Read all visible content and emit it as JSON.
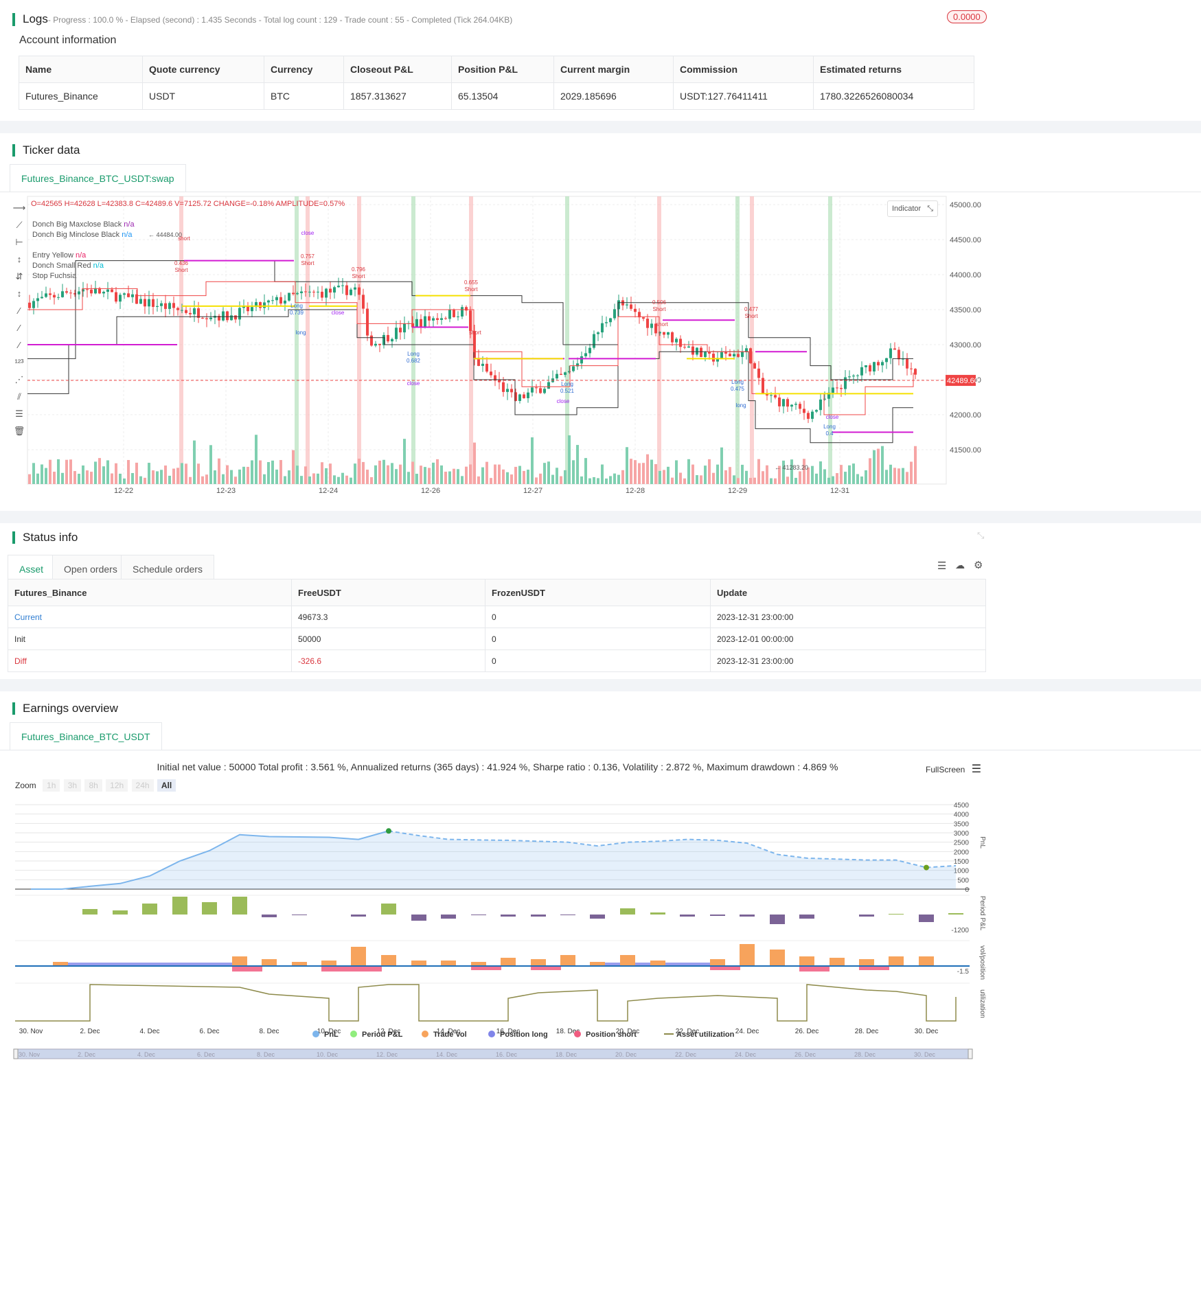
{
  "logs": {
    "title": "Logs",
    "summary": "- Progress : 100.0 % - Elapsed (second) : 1.435  Seconds - Total log count : 129 - Trade count : 55 - Completed (Tick 264.04KB)",
    "badge": "0.0000"
  },
  "account": {
    "title": "Account information",
    "headers": [
      "Name",
      "Quote currency",
      "Currency",
      "Closeout P&L",
      "Position P&L",
      "Current margin",
      "Commission",
      "Estimated returns"
    ],
    "row": [
      "Futures_Binance",
      "USDT",
      "BTC",
      "1857.313627",
      "65.13504",
      "2029.185696",
      "USDT:127.76411411",
      "1780.3226526080034"
    ]
  },
  "ticker": {
    "title": "Ticker data",
    "tab": "Futures_Binance_BTC_USDT:swap",
    "ohlc": "O=42565 H=42628 L=42383.8 C=42489.6 V=7125.72 CHANGE=-0.18% AMPLITUDE=0.57%",
    "indicator_btn": "Indicator",
    "legend": [
      {
        "label": "Donch Big Maxclose Black",
        "value": "n/a",
        "color": "#9c27b0"
      },
      {
        "label": "Donch Big Minclose Black",
        "value": "n/a",
        "color": "#2196f3"
      },
      {
        "label": "Entry Yellow",
        "value": "n/a",
        "color": "#e91e63"
      },
      {
        "label": "Donch Small Red",
        "value": "n/a",
        "color": "#00bcd4"
      },
      {
        "label": "Stop Fuchsia",
        "value": "",
        "color": "#9c27b0"
      }
    ],
    "price_axis": [
      "45000.00",
      "44500.00",
      "44000.00",
      "43500.00",
      "43000.00",
      "42500.00",
      "42000.00",
      "41500.00"
    ],
    "current_price": "42489.60",
    "x_axis": [
      "12-22",
      "12-23",
      "12-24",
      "12-26",
      "12-27",
      "12-28",
      "12-29",
      "12-31"
    ],
    "high_label": "44484.00",
    "low_label": "41283.20",
    "markers": [
      "short",
      "0.436",
      "Short",
      "close",
      "0.757",
      "Short",
      "Long",
      "0.739",
      "long",
      "close",
      "0.796",
      "Short",
      "Long",
      "0.682",
      "close",
      "0.655",
      "Short",
      "short",
      "Long",
      "0.521",
      "close",
      "0.506",
      "Short",
      "short",
      "0.477",
      "Short",
      "Long",
      "0.475",
      "long",
      "close",
      "Long",
      "0.4"
    ]
  },
  "status": {
    "title": "Status info",
    "tabs": [
      "Asset",
      "Open orders",
      "Schedule orders"
    ],
    "headers": [
      "Futures_Binance",
      "FreeUSDT",
      "FrozenUSDT",
      "Update"
    ],
    "rows": [
      [
        "Current",
        "49673.3",
        "0",
        "2023-12-31 23:00:00"
      ],
      [
        "Init",
        "50000",
        "0",
        "2023-12-01 00:00:00"
      ],
      [
        "Diff",
        "-326.6",
        "0",
        "2023-12-31 23:00:00"
      ]
    ]
  },
  "earnings": {
    "title": "Earnings overview",
    "tab": "Futures_Binance_BTC_USDT",
    "summary": "Initial net value : 50000 Total profit : 3.561 %, Annualized returns (365 days) : 41.924 %, Sharpe ratio : 0.136, Volatility : 2.872 %, Maximum drawdown : 4.869 %",
    "fullscreen": "FullScreen",
    "zoom_label": "Zoom",
    "zoom_options": [
      "1h",
      "3h",
      "8h",
      "12h",
      "24h",
      "All"
    ],
    "pnl_axis": [
      "4500",
      "4000",
      "3500",
      "3000",
      "2500",
      "2000",
      "1500",
      "1000",
      "500",
      "0"
    ],
    "period_axis": "-1200",
    "vol_axis": "-1.5",
    "side_labels": [
      "PnL",
      "Period P&L",
      "vol/position",
      "utilization"
    ],
    "x_axis": [
      "30. Nov",
      "2. Dec",
      "4. Dec",
      "6. Dec",
      "8. Dec",
      "10. Dec",
      "12. Dec",
      "14. Dec",
      "16. Dec",
      "18. Dec",
      "20. Dec",
      "22. Dec",
      "24. Dec",
      "26. Dec",
      "28. Dec",
      "30. Dec"
    ],
    "legend": [
      {
        "label": "PnL",
        "color": "#7cb5ec"
      },
      {
        "label": "Period P&L",
        "color": "#90ed7d"
      },
      {
        "label": "Trade Vol",
        "color": "#f7a35c"
      },
      {
        "label": "Position long",
        "color": "#8085e9"
      },
      {
        "label": "Position short",
        "color": "#f15c80"
      },
      {
        "label": "Asset utilization",
        "color": "#8d8a4a"
      }
    ]
  }
}
